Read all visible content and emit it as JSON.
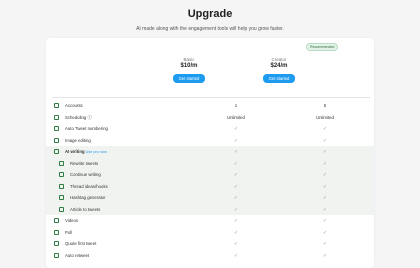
{
  "page": {
    "title": "Upgrade",
    "subtitle": "AI made along with the engagement tools will help you grow faster."
  },
  "plans": [
    {
      "name": "Basic",
      "price": "$10/m",
      "cta": "Get started",
      "badge": ""
    },
    {
      "name": "Creator",
      "price": "$24/m",
      "cta": "Get started",
      "badge": "Recommended"
    }
  ],
  "features": [
    {
      "label": "Accounts",
      "basic": "1",
      "creator": "5",
      "icon": "users-icon",
      "sub": false,
      "ai": false
    },
    {
      "label": "Scheduling ⓘ",
      "basic": "Unlimited",
      "creator": "Unlimited",
      "icon": "calendar-icon",
      "sub": false,
      "ai": false
    },
    {
      "label": "Auto Tweet numbering",
      "basic": "✓",
      "creator": "✓",
      "icon": "list-number-icon",
      "sub": false,
      "ai": false
    },
    {
      "label": "Image editing",
      "basic": "✓",
      "creator": "✓",
      "icon": "image-icon",
      "sub": false,
      "ai": false
    },
    {
      "label": "AI writing",
      "tag": "Use pro now",
      "basic": "✓",
      "creator": "✓",
      "icon": "sparkle-icon",
      "sub": false,
      "ai": true
    },
    {
      "label": "Rewrite tweets",
      "basic": "✓",
      "creator": "✓",
      "icon": "rewrite-icon",
      "sub": true,
      "ai": true
    },
    {
      "label": "Continue writing",
      "basic": "✓",
      "creator": "✓",
      "icon": "pen-icon",
      "sub": true,
      "ai": true
    },
    {
      "label": "Thread ideas/hooks",
      "basic": "✓",
      "creator": "✓",
      "icon": "thread-icon",
      "sub": true,
      "ai": true
    },
    {
      "label": "Hashtag generator",
      "basic": "✓",
      "creator": "✓",
      "icon": "hashtag-icon",
      "sub": true,
      "ai": true
    },
    {
      "label": "Article to tweets",
      "basic": "✓",
      "creator": "✓",
      "icon": "article-icon",
      "sub": true,
      "ai": true
    },
    {
      "label": "Videos",
      "basic": "✓",
      "creator": "✓",
      "icon": "video-icon",
      "sub": false,
      "ai": false
    },
    {
      "label": "Poll",
      "basic": "✓",
      "creator": "✓",
      "icon": "poll-icon",
      "sub": false,
      "ai": false
    },
    {
      "label": "Quote first tweet",
      "basic": "✓",
      "creator": "✓",
      "icon": "quote-icon",
      "sub": false,
      "ai": false
    },
    {
      "label": "Auto retweet",
      "basic": "✓",
      "creator": "✓",
      "icon": "retweet-icon",
      "sub": false,
      "ai": false
    }
  ]
}
